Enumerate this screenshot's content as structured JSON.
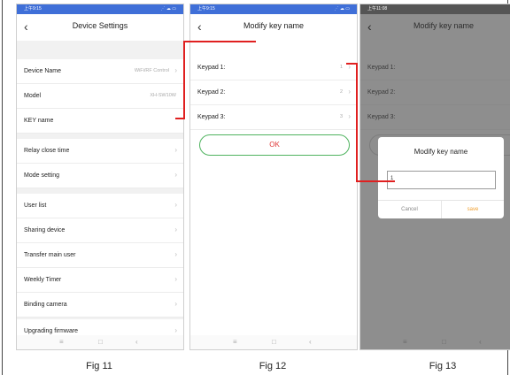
{
  "fig11": {
    "status_time": "上午9:15",
    "status_icons": "⋰ ☁ ▭",
    "title": "Device Settings",
    "rows": [
      {
        "label": "Device Name",
        "value": "WiFi/RF Control"
      },
      {
        "label": "Model",
        "value": "XH-SW10W"
      },
      {
        "label": "KEY name",
        "value": ""
      },
      {
        "label": "Relay close time",
        "value": ""
      },
      {
        "label": "Mode setting",
        "value": ""
      },
      {
        "label": "User list",
        "value": ""
      },
      {
        "label": "Sharing device",
        "value": ""
      },
      {
        "label": "Transfer main user",
        "value": ""
      },
      {
        "label": "Weekly Timer",
        "value": ""
      },
      {
        "label": "Binding camera",
        "value": ""
      },
      {
        "label": "Upgrading firmware",
        "value": ""
      }
    ],
    "caption": "Fig 11"
  },
  "fig12": {
    "status_time": "上午9:15",
    "status_icons": "⋰ ☁ ▭",
    "title": "Modify key name",
    "rows": [
      {
        "label": "Keypad 1:",
        "value": "1"
      },
      {
        "label": "Keypad 2:",
        "value": "2"
      },
      {
        "label": "Keypad 3:",
        "value": "3"
      }
    ],
    "ok_label": "OK",
    "caption": "Fig 12"
  },
  "fig13": {
    "status_time": "上午11:08",
    "status_icons": "⋰ ☁",
    "title": "Modify key name",
    "rows": [
      {
        "label": "Keypad 1:"
      },
      {
        "label": "Keypad 2:"
      },
      {
        "label": "Keypad 3:"
      }
    ],
    "dialog": {
      "title": "Modify key name",
      "input_value": "1",
      "cancel_label": "Cancel",
      "save_label": "save"
    },
    "caption": "Fig 13"
  },
  "chevron_glyph": "›",
  "back_glyph": "‹",
  "nav_glyphs": {
    "menu": "≡",
    "home": "□",
    "back": "‹"
  },
  "colors": {
    "status_bar": "#3f6fd8",
    "callout": "#e02020",
    "ok_border": "#4fb35f",
    "ok_text": "#e03a3a",
    "save_text": "#f0a030"
  }
}
